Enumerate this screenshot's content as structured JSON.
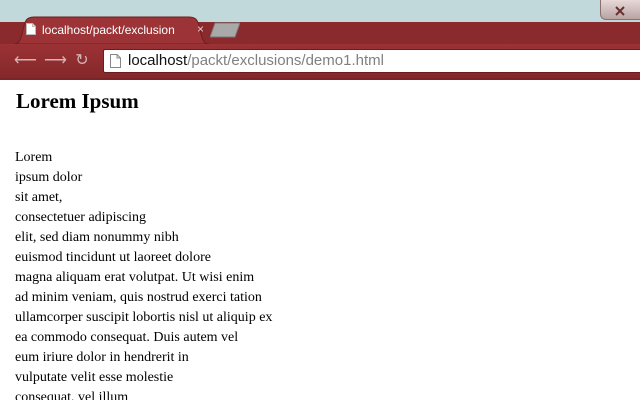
{
  "tab": {
    "title": "localhost/packt/exclusion",
    "close": "×"
  },
  "address": {
    "host": "localhost",
    "path": "/packt/exclusions/demo1.html"
  },
  "content": {
    "heading": "Lorem Ipsum",
    "lines": [
      "Lorem",
      "ipsum dolor",
      "sit amet,",
      "consectetuer adipiscing",
      "elit, sed diam nonummy nibh",
      "euismod tincidunt ut laoreet dolore",
      "magna aliquam erat volutpat. Ut wisi enim",
      "ad minim veniam, quis nostrud exerci tation",
      "ullamcorper suscipit lobortis nisl ut aliquip ex",
      "ea commodo consequat. Duis autem vel",
      "eum iriure dolor in hendrerit in",
      "vulputate velit esse molestie",
      "consequat, vel illum"
    ]
  },
  "icons": [
    "page-icon",
    "close-icon",
    "back-arrow-icon",
    "forward-arrow-icon",
    "reload-icon",
    "new-tab-icon",
    "window-close-icon"
  ],
  "colors": {
    "theme": "#8a2a2c",
    "tab": "#9c3437",
    "desktop": "#c1d9db",
    "text_url_path": "#808080"
  }
}
